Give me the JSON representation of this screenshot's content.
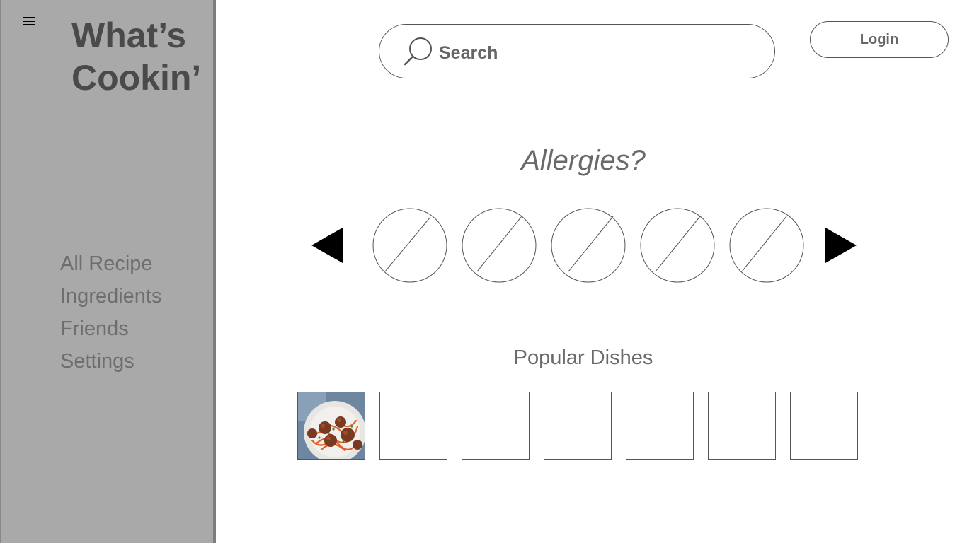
{
  "app": {
    "title": "What’s Cookin’"
  },
  "sidebar": {
    "menu_icon": "hamburger-menu-icon",
    "items": [
      {
        "label": "All Recipe"
      },
      {
        "label": "Ingredients"
      },
      {
        "label": "Friends"
      },
      {
        "label": "Settings"
      }
    ]
  },
  "search": {
    "icon": "search-icon",
    "placeholder": "Search",
    "value": ""
  },
  "login": {
    "label": "Login"
  },
  "allergies": {
    "title": "Allergies?",
    "prev_icon": "triangle-left-icon",
    "next_icon": "triangle-right-icon",
    "options_count_visible": 5
  },
  "popular": {
    "title": "Popular Dishes",
    "dishes": [
      {
        "image": "spaghetti-meatballs"
      },
      {
        "image": "placeholder"
      },
      {
        "image": "placeholder"
      },
      {
        "image": "placeholder"
      },
      {
        "image": "placeholder"
      },
      {
        "image": "placeholder"
      },
      {
        "image": "placeholder"
      }
    ]
  },
  "colors": {
    "sidebar_bg": "#a9a9a9",
    "sidebar_border": "#7d7d7d",
    "title_text": "#4a4a4a",
    "nav_text": "#6e6e6e"
  }
}
